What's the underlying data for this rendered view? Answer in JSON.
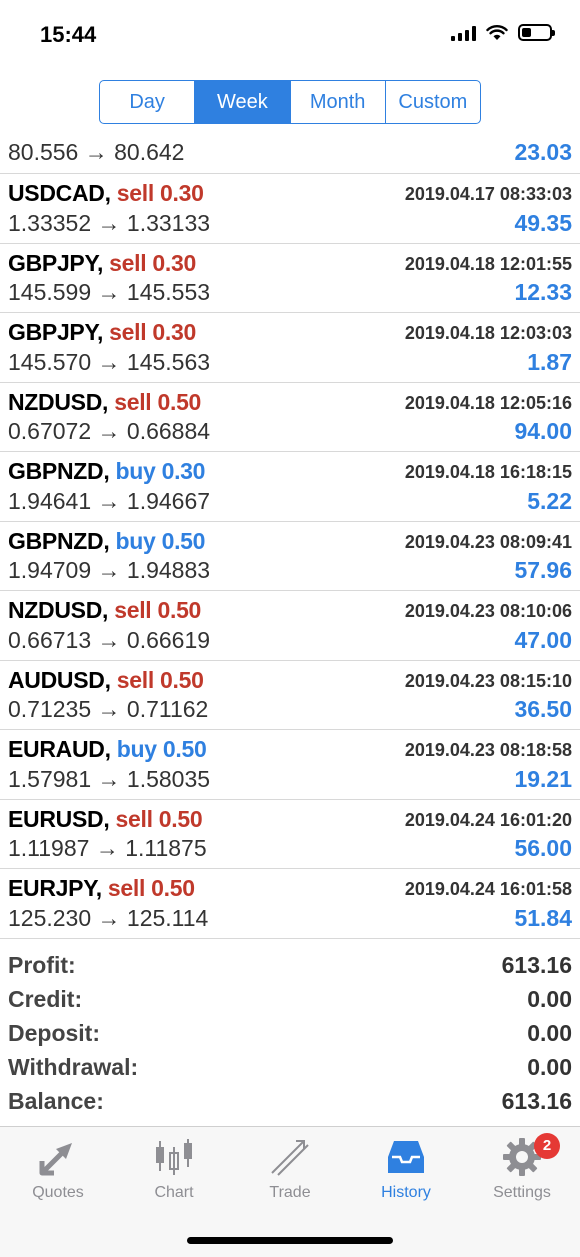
{
  "status": {
    "time": "15:44"
  },
  "segments": {
    "day": "Day",
    "week": "Week",
    "month": "Month",
    "custom": "Custom",
    "active": "Week"
  },
  "partial_row": {
    "prices": "80.556 → 80.642",
    "profit": "23.03"
  },
  "trades": [
    {
      "symbol": "USDCAD",
      "side": "sell",
      "volume": "0.30",
      "date": "2019.04.17 08:33:03",
      "prices": "1.33352 → 1.33133",
      "profit": "49.35"
    },
    {
      "symbol": "GBPJPY",
      "side": "sell",
      "volume": "0.30",
      "date": "2019.04.18 12:01:55",
      "prices": "145.599 → 145.553",
      "profit": "12.33"
    },
    {
      "symbol": "GBPJPY",
      "side": "sell",
      "volume": "0.30",
      "date": "2019.04.18 12:03:03",
      "prices": "145.570 → 145.563",
      "profit": "1.87"
    },
    {
      "symbol": "NZDUSD",
      "side": "sell",
      "volume": "0.50",
      "date": "2019.04.18 12:05:16",
      "prices": "0.67072 → 0.66884",
      "profit": "94.00"
    },
    {
      "symbol": "GBPNZD",
      "side": "buy",
      "volume": "0.30",
      "date": "2019.04.18 16:18:15",
      "prices": "1.94641 → 1.94667",
      "profit": "5.22"
    },
    {
      "symbol": "GBPNZD",
      "side": "buy",
      "volume": "0.50",
      "date": "2019.04.23 08:09:41",
      "prices": "1.94709 → 1.94883",
      "profit": "57.96"
    },
    {
      "symbol": "NZDUSD",
      "side": "sell",
      "volume": "0.50",
      "date": "2019.04.23 08:10:06",
      "prices": "0.66713 → 0.66619",
      "profit": "47.00"
    },
    {
      "symbol": "AUDUSD",
      "side": "sell",
      "volume": "0.50",
      "date": "2019.04.23 08:15:10",
      "prices": "0.71235 → 0.71162",
      "profit": "36.50"
    },
    {
      "symbol": "EURAUD",
      "side": "buy",
      "volume": "0.50",
      "date": "2019.04.23 08:18:58",
      "prices": "1.57981 → 1.58035",
      "profit": "19.21"
    },
    {
      "symbol": "EURUSD",
      "side": "sell",
      "volume": "0.50",
      "date": "2019.04.24 16:01:20",
      "prices": "1.11987 → 1.11875",
      "profit": "56.00"
    },
    {
      "symbol": "EURJPY",
      "side": "sell",
      "volume": "0.50",
      "date": "2019.04.24 16:01:58",
      "prices": "125.230 → 125.114",
      "profit": "51.84"
    }
  ],
  "summary": [
    {
      "label": "Profit:",
      "value": "613.16"
    },
    {
      "label": "Credit:",
      "value": "0.00"
    },
    {
      "label": "Deposit:",
      "value": "0.00"
    },
    {
      "label": "Withdrawal:",
      "value": "0.00"
    },
    {
      "label": "Balance:",
      "value": "613.16"
    }
  ],
  "tabs": [
    {
      "label": "Quotes",
      "icon": "quotes-arrows-icon"
    },
    {
      "label": "Chart",
      "icon": "candlestick-chart-icon"
    },
    {
      "label": "Trade",
      "icon": "trade-line-icon"
    },
    {
      "label": "History",
      "icon": "inbox-tray-icon",
      "active": true
    },
    {
      "label": "Settings",
      "icon": "gear-icon",
      "badge": "2"
    }
  ],
  "colors": {
    "accent": "#2f80e0",
    "sell": "#c0392b",
    "buy": "#2f80e0",
    "badge": "#e53935"
  }
}
